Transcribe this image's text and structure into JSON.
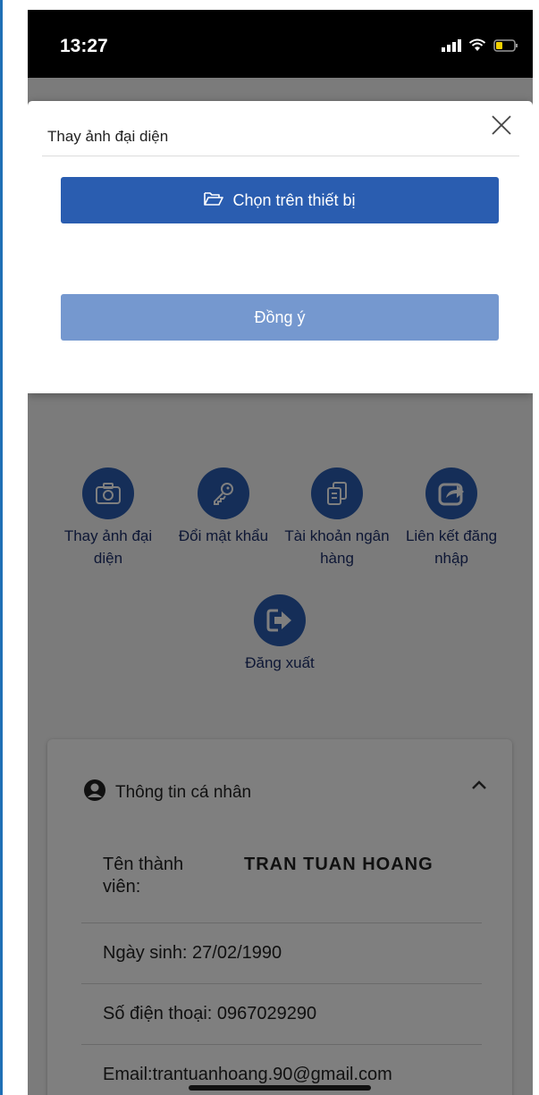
{
  "status_bar": {
    "time": "13:27"
  },
  "modal": {
    "title": "Thay ảnh đại diện",
    "choose_button": "Chọn trên thiết bị",
    "agree_button": "Đồng ý",
    "close_icon": "close-icon",
    "folder_icon": "folder-open-icon"
  },
  "shortcuts": [
    {
      "label": "Thay ảnh đại diện",
      "icon": "camera-icon"
    },
    {
      "label": "Đổi mật khẩu",
      "icon": "key-icon"
    },
    {
      "label": "Tài khoản ngân hàng",
      "icon": "documents-icon"
    },
    {
      "label": "Liên kết đăng nhập",
      "icon": "share-icon"
    },
    {
      "label": "Đăng xuất",
      "icon": "logout-icon"
    }
  ],
  "personal_info": {
    "title": "Thông tin cá nhân",
    "name_label": "Tên thành viên:",
    "name_value": "TRAN TUAN HOANG",
    "dob": "Ngày sinh: 27/02/1990",
    "phone": "Số điện thoại: 0967029290",
    "email": "Email:trantuanhoang.90@gmail.com"
  },
  "colors": {
    "primary": "#2a5db0",
    "primary_disabled": "#7598cf"
  }
}
